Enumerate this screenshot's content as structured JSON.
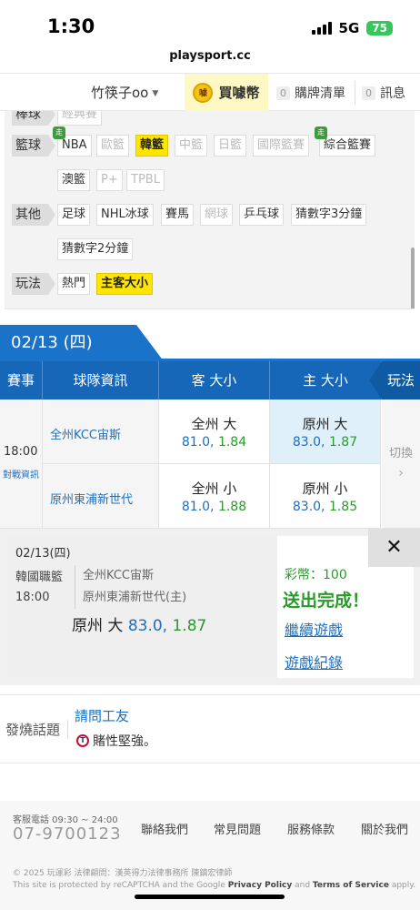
{
  "status_bar": {
    "time": "1:30",
    "network": "5G",
    "battery": "75"
  },
  "browser": {
    "url": "playsport.cc"
  },
  "topnav": {
    "username": "竹筷子oo",
    "buy_coins": "買噱幣",
    "coin_icon_text": "噱",
    "cart_count": "0",
    "cart_label": "購牌清單",
    "msg_count": "0",
    "msg_label": "訊息"
  },
  "filters": {
    "row0": {
      "label": "棒球",
      "chips": [
        "經典賽"
      ]
    },
    "basketball": {
      "label": "籃球",
      "chips": [
        "NBA",
        "歐籃",
        "韓籃",
        "中籃",
        "日籃",
        "國際籃賽",
        "綜合籃賽",
        "澳籃",
        "P+",
        "TPBL"
      ]
    },
    "other": {
      "label": "其他",
      "chips": [
        "足球",
        "NHL冰球",
        "賽馬",
        "網球",
        "乒乓球",
        "猜數字3分鐘",
        "猜數字2分鐘"
      ]
    },
    "mode": {
      "label": "玩法",
      "chips": [
        "熱門",
        "主客大小"
      ]
    },
    "walk_badge": "走"
  },
  "date_tab": "02/13 (四)",
  "table": {
    "headers": [
      "賽事",
      "球隊資訊",
      "客 大小",
      "主 大小",
      "玩法"
    ],
    "time": "18:00",
    "vs_link": "對戰資訊",
    "away_team": "全州KCC宙斯",
    "home_team": "原州東浦新世代",
    "away_over": {
      "label": "全州 大",
      "line": "81.0",
      "odds": "1.84"
    },
    "home_over": {
      "label": "原州 大",
      "line": "83.0",
      "odds": "1.87"
    },
    "away_under": {
      "label": "全州 小",
      "line": "81.0",
      "odds": "1.88"
    },
    "home_under": {
      "label": "原州 小",
      "line": "83.0",
      "odds": "1.85"
    },
    "switch_label": "切換",
    "switch_chevron": "›"
  },
  "popup": {
    "date": "02/13(四)",
    "league": "韓國職籃",
    "time": "18:00",
    "team1": "全州KCC宙斯",
    "team2": "原州東浦新世代(主)",
    "pick_label": "原州 大",
    "pick_line": "83.0,",
    "pick_odds": "1.87",
    "coins": "彩幣：100",
    "done": "送出完成！",
    "continue": "繼續遊戲",
    "history": "遊戲紀錄",
    "close": "✕"
  },
  "hot_topic": {
    "label": "發燒話題",
    "title": "請問工友",
    "team_logo": "T",
    "snippet": "賭性堅強。"
  },
  "footer": {
    "service_hours": "客服電話 09:30 ~ 24:00",
    "phone": "07-9700123",
    "links": [
      "聯絡我們",
      "常見問題",
      "服務條款",
      "關於我們"
    ],
    "copyright": "© 2025 玩運彩 法律顧問：漢英得力法律事務所 陳鎮宏律師",
    "captcha_prefix": "This site is protected by reCAPTCHA and the Google",
    "privacy": "Privacy Policy",
    "and": "and",
    "terms": "Terms of Service",
    "apply": "apply."
  }
}
